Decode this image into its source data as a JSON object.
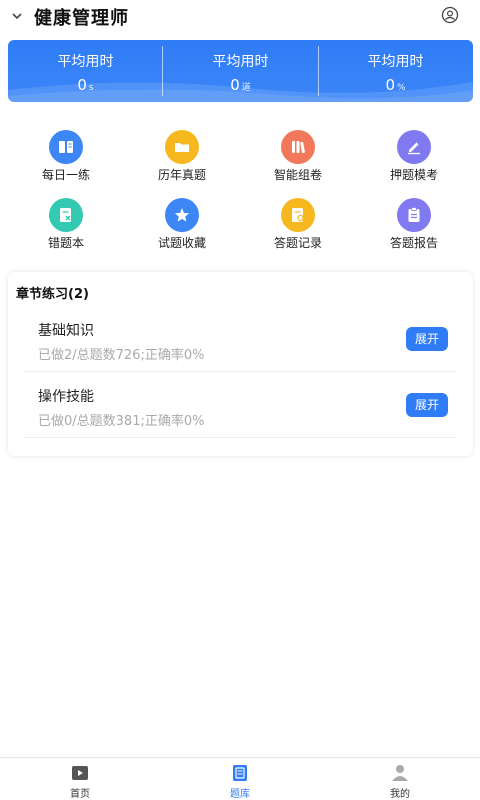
{
  "header": {
    "title": "健康管理师",
    "collapse_icon": "chevron-down-icon",
    "user_icon": "user-circle-icon"
  },
  "stats": [
    {
      "label": "平均用时",
      "value": "0",
      "unit": "s"
    },
    {
      "label": "平均用时",
      "value": "0",
      "unit": "道"
    },
    {
      "label": "平均用时",
      "value": "0",
      "unit": "%"
    }
  ],
  "grid": [
    {
      "label": "每日一练",
      "icon": "book-icon",
      "color": "#3c86f6"
    },
    {
      "label": "历年真题",
      "icon": "folder-icon",
      "color": "#f6b71f"
    },
    {
      "label": "智能组卷",
      "icon": "books-icon",
      "color": "#f1785a"
    },
    {
      "label": "押题模考",
      "icon": "pen-icon",
      "color": "#8079f0"
    },
    {
      "label": "错题本",
      "icon": "error-note-icon",
      "color": "#34c9b2"
    },
    {
      "label": "试题收藏",
      "icon": "star-icon",
      "color": "#3c86f6"
    },
    {
      "label": "答题记录",
      "icon": "record-icon",
      "color": "#f6b71f"
    },
    {
      "label": "答题报告",
      "icon": "report-icon",
      "color": "#8079f0"
    }
  ],
  "chapters": {
    "title": "章节练习(2)",
    "items": [
      {
        "name": "基础知识",
        "meta": "已做2/总题数726;正确率0%",
        "button": "展开"
      },
      {
        "name": "操作技能",
        "meta": "已做0/总题数381;正确率0%",
        "button": "展开"
      }
    ]
  },
  "nav": [
    {
      "label": "首页",
      "icon": "video-icon",
      "active": false
    },
    {
      "label": "题库",
      "icon": "question-bank-icon",
      "active": true
    },
    {
      "label": "我的",
      "icon": "person-icon",
      "active": false
    }
  ],
  "colors": {
    "primary": "#2f7cf6",
    "muted_text": "#aaaaaa"
  }
}
